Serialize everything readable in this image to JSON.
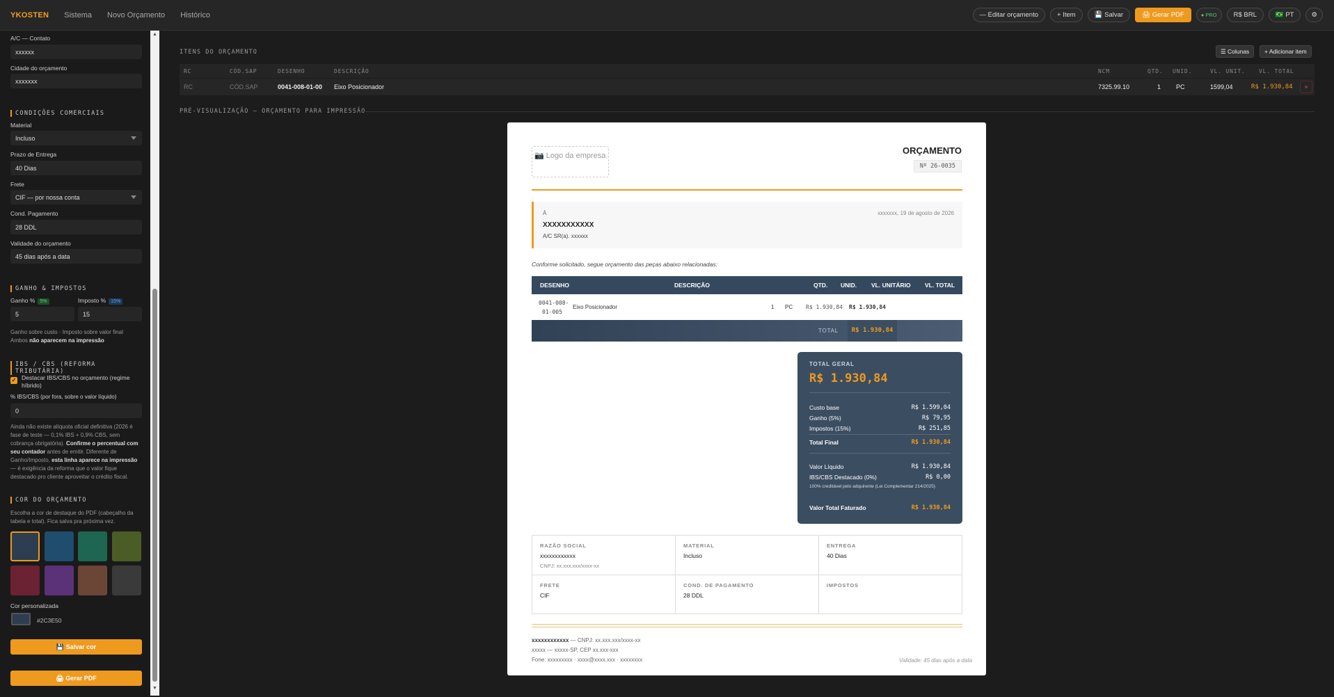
{
  "topbar": {
    "brand": "YKOSTEN",
    "nav": [
      "Sistema",
      "Novo Orçamento",
      "Histórico"
    ],
    "edit_label": "— Editar orçamento",
    "item_label": "+ Item",
    "save_label": "💾 Salvar",
    "pdf_label": "🖨 Gerar PDF",
    "pro_label": "● PRO",
    "currency_label": "R$ BRL",
    "lang_label": "🇧🇷 PT",
    "settings_icon": "⚙"
  },
  "sidebar": {
    "contact_label": "A/C — Contato",
    "contact_value": "xxxxxx",
    "city_label": "Cidade do orçamento",
    "city_value": "xxxxxxx",
    "commercial_title": "CONDIÇÕES COMERCIAIS",
    "material_label": "Material",
    "material_value": "Incluso",
    "deadline_label": "Prazo de Entrega",
    "deadline_value": "40 Dias",
    "freight_label": "Frete",
    "freight_value": "CIF — por nossa conta",
    "payment_label": "Cond. Pagamento",
    "payment_value": "28 DDL",
    "validity_label": "Validade do orçamento",
    "validity_value": "45 dias após a data",
    "gain_title": "GANHO & IMPOSTOS",
    "gain_label": "Ganho %",
    "gain_badge": "5%",
    "gain_value": "5",
    "tax_label": "Imposto %",
    "tax_badge": "15%",
    "tax_value": "15",
    "gain_note_1": "Ganho sobre custo · Imposto sobre valor final",
    "gain_note_2a": "Ambos ",
    "gain_note_2b": "não aparecem na impressão",
    "ibs_title": "IBS / CBS (REFORMA TRIBUTÁRIA)",
    "ibs_checkbox_label": "Destacar IBS/CBS no orçamento (regime híbrido)",
    "ibs_pct_label": "% IBS/CBS (por fora, sobre o valor líquido)",
    "ibs_pct_value": "0",
    "ibs_note_a": "Ainda não existe alíquota oficial definitiva (2026 é fase de teste — 0,1% IBS + 0,9% CBS, sem cobrança obrigatória). ",
    "ibs_note_b": "Confirme o percentual com seu contador",
    "ibs_note_c": " antes de emitir. Diferente de Ganho/Imposto, ",
    "ibs_note_d": "esta linha aparece na impressão",
    "ibs_note_e": " — é exigência da reforma que o valor fique destacado pro cliente aproveitar o crédito fiscal.",
    "color_title": "COR DO ORÇAMENTO",
    "color_note": "Escolha a cor de destaque do PDF (cabeçalho da tabela e total). Fica salva pra próxima vez.",
    "swatches": [
      "#2c3e50",
      "#1e4d6e",
      "#1e6652",
      "#4a5d25",
      "#6b2233",
      "#5b3278",
      "#6b4636",
      "#3a3a3a"
    ],
    "custom_color_label": "Cor personalizada",
    "custom_color_value": "#2C3E50",
    "save_color_label": "💾 Salvar cor",
    "generate_pdf_label": "🖨 Gerar PDF"
  },
  "items": {
    "title": "ITENS DO ORÇAMENTO",
    "columns_button": "☰ Colunas",
    "add_button": "+ Adicionar item",
    "headers": [
      "RC",
      "CÓD.SAP",
      "DESENHO",
      "DESCRIÇÃO",
      "NCM",
      "QTD.",
      "UNID.",
      "VL. UNIT.",
      "VL. TOTAL"
    ],
    "row": {
      "rc": "RC",
      "sap": "CÓD.SAP",
      "drawing": "0041-008-01-00",
      "description": "Eixo Posicionador",
      "ncm": "7325.99.10",
      "qty": "1",
      "unit": "PC",
      "unit_price": "1599,04",
      "total": "R$ 1.930,84",
      "delete": "×"
    }
  },
  "preview": {
    "title": "PRÉ-VISUALIZAÇÃO — ORÇAMENTO PARA IMPRESSÃO",
    "logo_text": "📷 Logo da empresa",
    "doc_title": "ORÇAMENTO",
    "doc_number": "Nº 26-0035",
    "to_label": "À",
    "date_line": "xxxxxxx, 19 de agosto de 2026",
    "client": "XXXXXXXXXXX",
    "attention": "A/C SR(a). xxxxxx",
    "intro": "Conforme solicitado, segue orçamento das peças abaixo relacionadas:",
    "table_headers": {
      "drawing": "DESENHO",
      "description": "DESCRIÇÃO",
      "qty": "QTD.",
      "unit": "UNID.",
      "unit_price": "VL. UNITÁRIO",
      "total": "VL. TOTAL"
    },
    "table_row": {
      "drawing_1": "0041-008-",
      "drawing_2": "01-005",
      "description": "Eixo Posicionador",
      "qty": "1",
      "unit": "PC",
      "unit_price": "R$ 1.930,84",
      "total": "R$ 1.930,84"
    },
    "total_label": "TOTAL",
    "total_value": "R$ 1.930,84",
    "summary": {
      "title": "TOTAL GERAL",
      "big_value": "R$ 1.930,84",
      "base_label": "Custo base",
      "base_value": "R$ 1.599,04",
      "gain_label": "Ganho (5%)",
      "gain_value": "R$ 79,95",
      "tax_label": "Impostos (15%)",
      "tax_value": "R$ 251,85",
      "final_label": "Total Final",
      "final_value": "R$ 1.930,84",
      "net_label": "Valor Líquido",
      "net_value": "R$ 1.930,84",
      "ibs_label": "IBS/CBS Destacado (0%)",
      "ibs_value": "R$ 0,00",
      "ibs_note": "100% creditável pelo adquirente (Lei Complementar 214/2025)",
      "billed_label": "Valor Total Faturado",
      "billed_value": "R$ 1.930,84"
    },
    "info": {
      "company_h": "RAZÃO SOCIAL",
      "company_v": "xxxxxxxxxxxx",
      "company_cnpj": "CNPJ: xx.xxx.xxx/xxxx-xx",
      "material_h": "MATERIAL",
      "material_v": "Incluso",
      "delivery_h": "ENTREGA",
      "delivery_v": "40 Dias",
      "freight_h": "FRETE",
      "freight_v": "CIF",
      "payment_h": "COND. DE PAGAMENTO",
      "payment_v": "28 DDL",
      "taxes_h": "IMPOSTOS",
      "taxes_v": ""
    },
    "footer": {
      "line1_a": "xxxxxxxxxxxx",
      "line1_b": " — CNPJ: xx.xxx.xxx/xxxx-xx",
      "line2": "xxxxx — xxxxx-SP, CEP xx.xxx-xxx",
      "line3": "Fone: xxxxxxxxx  ·  xxxx@xxxx.xxx  ·  xxxxxxxx",
      "validity": "Validade: 45 dias após a data"
    }
  },
  "colors": {
    "accent": "#ee9a1e",
    "table_header": "#34495e",
    "summary_bg": "#3b4d61"
  }
}
